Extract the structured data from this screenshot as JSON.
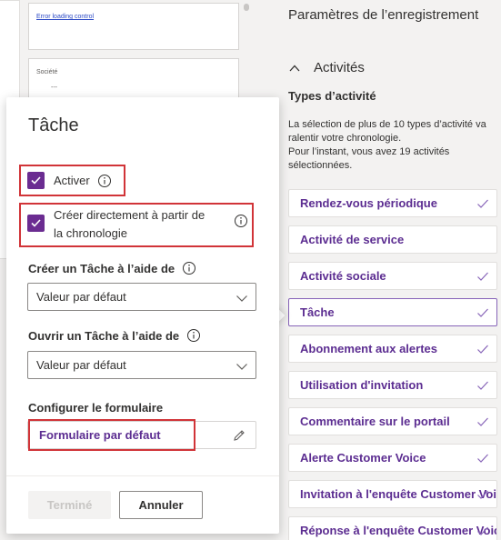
{
  "background": {
    "error_link": "Error loading control",
    "societe_label": "Société",
    "societe_value": "---"
  },
  "right_panel": {
    "title": "Paramètres de l’enregistrement",
    "section_title": "Activités",
    "types_title": "Types d’activité",
    "types_desc_1": "La sélection de plus de 10 types d’activité va ralentir votre chronologie.",
    "types_desc_2": "Pour l’instant, vous avez 19 activités sélectionnées.",
    "activities": [
      {
        "label": "Rendez-vous périodique",
        "checked": true,
        "selected": false
      },
      {
        "label": "Activité de service",
        "checked": false,
        "selected": false
      },
      {
        "label": "Activité sociale",
        "checked": true,
        "selected": false
      },
      {
        "label": "Tâche",
        "checked": true,
        "selected": true
      },
      {
        "label": "Abonnement aux alertes",
        "checked": true,
        "selected": false
      },
      {
        "label": "Utilisation d'invitation",
        "checked": true,
        "selected": false
      },
      {
        "label": "Commentaire sur le portail",
        "checked": true,
        "selected": false
      },
      {
        "label": "Alerte Customer Voice",
        "checked": true,
        "selected": false
      },
      {
        "label": "Invitation à l'enquête Customer Voice",
        "checked": true,
        "selected": false
      },
      {
        "label": "Réponse à l'enquête Customer Voice",
        "checked": true,
        "selected": false
      }
    ]
  },
  "popup": {
    "title": "Tâche",
    "enable_label": "Activer",
    "create_direct_line1": "Créer directement à partir de",
    "create_direct_line2": "la chronologie",
    "create_with_label": "Créer un Tâche à l’aide de",
    "create_with_value": "Valeur par défaut",
    "open_with_label": "Ouvrir un Tâche à l’aide de",
    "open_with_value": "Valeur par défaut",
    "configure_form_label": "Configurer le formulaire",
    "form_link": "Formulaire par défaut",
    "done_button": "Terminé",
    "cancel_button": "Annuler"
  },
  "colors": {
    "accent": "#6b2c91",
    "link_purple": "#5c2d91",
    "highlight_red": "#d13438"
  }
}
